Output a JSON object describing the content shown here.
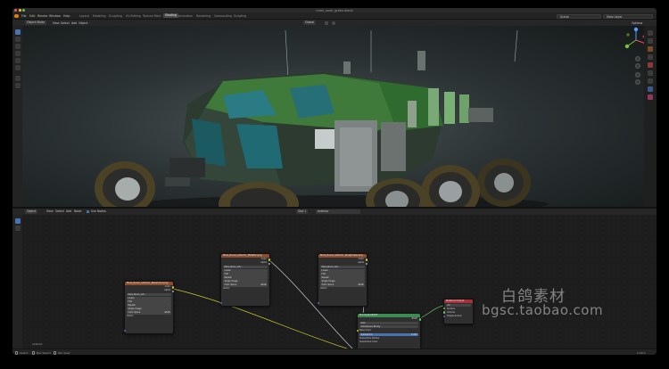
{
  "window": {
    "title": "mars_rover_green.blend"
  },
  "menu": {
    "items": [
      "File",
      "Edit",
      "Render",
      "Window",
      "Help"
    ],
    "workspaces": [
      "Layout",
      "Modeling",
      "Sculpting",
      "UV Editing",
      "Texture Paint",
      "Shading",
      "Animation",
      "Rendering",
      "Compositing",
      "Scripting"
    ],
    "active_workspace": "Shading",
    "scene": "Scene",
    "view_layer": "View Layer"
  },
  "viewport_header": {
    "mode": "Object Mode",
    "menus": [
      "View",
      "Select",
      "Add",
      "Object"
    ],
    "transform": "Global",
    "options": "Options"
  },
  "node_header": {
    "editor": "Object",
    "menus": [
      "View",
      "Select",
      "Add",
      "Node"
    ],
    "use_nodes": "Use Nodes",
    "slot": "Slot 1",
    "material": "exterior"
  },
  "nodes": {
    "image1": {
      "title": "Mars_Rover_exterior_BaseColor.png",
      "outputs": [
        "Color",
        "Alpha"
      ],
      "image": "Mars_Rover_ext...",
      "fields": [
        {
          "label": "Linear",
          "value": ""
        },
        {
          "label": "Flat",
          "value": ""
        },
        {
          "label": "Repeat",
          "value": ""
        },
        {
          "label": "Single Image",
          "value": ""
        },
        {
          "label": "Color Space",
          "value": "sRGB"
        }
      ],
      "input": "Vector"
    },
    "image2": {
      "title": "Mars_Rover_exterior_Metallic.png",
      "outputs": [
        "Color",
        "Alpha"
      ],
      "image": "Mars_Rover_ext...",
      "fields": [
        {
          "label": "Linear",
          "value": ""
        },
        {
          "label": "Flat",
          "value": ""
        },
        {
          "label": "Repeat",
          "value": ""
        },
        {
          "label": "Single Image",
          "value": ""
        },
        {
          "label": "Color Space",
          "value": "sRGB"
        }
      ],
      "input": "Vector"
    },
    "image3": {
      "title": "Mars_Rover_exterior_Roughness.png",
      "outputs": [
        "Color",
        "Alpha"
      ],
      "image": "Mars_Rover_ext...",
      "fields": [
        {
          "label": "Linear",
          "value": ""
        },
        {
          "label": "Flat",
          "value": ""
        },
        {
          "label": "Repeat",
          "value": ""
        },
        {
          "label": "Single Image",
          "value": ""
        },
        {
          "label": "Color Space",
          "value": "sRGB"
        }
      ],
      "input": "Vector"
    },
    "bsdf": {
      "title": "Principled BSDF",
      "output": "BSDF",
      "fields": [
        {
          "label": "GGX",
          "value": ""
        },
        {
          "label": "Christensen-Burley",
          "value": ""
        },
        {
          "label": "Base Color",
          "value": ""
        },
        {
          "label": "Subsurface",
          "value": "0.000"
        },
        {
          "label": "Subsurface Radius",
          "value": ""
        },
        {
          "label": "Subsurface Color",
          "value": ""
        }
      ]
    },
    "output": {
      "title": "Material Output",
      "target": "All",
      "inputs": [
        "Surface",
        "Volume",
        "Displacement"
      ]
    },
    "label": "exterior"
  },
  "statusbar": {
    "left": [
      "Select",
      "Box Select",
      "Pan View"
    ],
    "right": "2.90.0"
  },
  "watermark": {
    "cn": "白鸽素材",
    "url": "bgsc.taobao.com"
  }
}
